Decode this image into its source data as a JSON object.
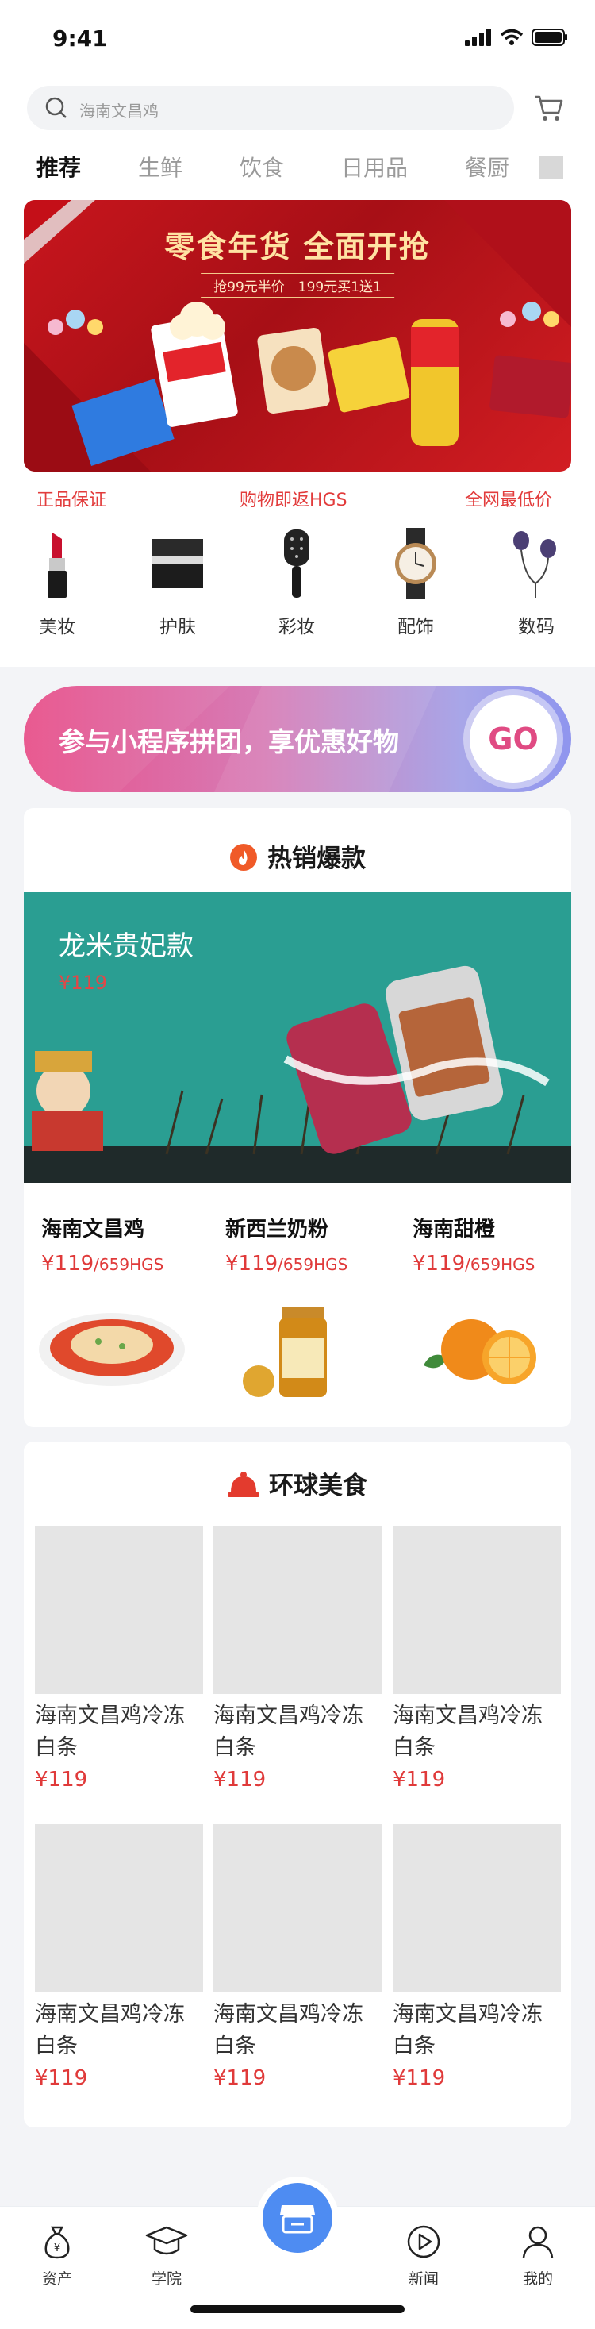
{
  "status": {
    "time": "9:41"
  },
  "search": {
    "placeholder": "海南文昌鸡"
  },
  "tabs": [
    "推荐",
    "生鲜",
    "饮食",
    "日用品",
    "餐厨"
  ],
  "banner": {
    "title": "零食年货 全面开抢",
    "subtitle": "抢99元半价　199元买1送1"
  },
  "guarantees": [
    "正品保证",
    "购物即返HGS",
    "全网最低价"
  ],
  "categories": [
    {
      "label": "美妆",
      "icon": "lipstick-icon"
    },
    {
      "label": "护肤",
      "icon": "skincare-box-icon"
    },
    {
      "label": "彩妆",
      "icon": "hairbrush-icon"
    },
    {
      "label": "配饰",
      "icon": "watch-icon"
    },
    {
      "label": "数码",
      "icon": "earphones-icon"
    }
  ],
  "promo": {
    "text": "参与小程序拼团，享优惠好物",
    "go": "GO"
  },
  "hot": {
    "title": "热销爆款",
    "hero": {
      "name": "龙米贵妃款",
      "price": "¥119"
    },
    "products": [
      {
        "name": "海南文昌鸡",
        "price": "¥119",
        "hgs": "/659HGS"
      },
      {
        "name": "新西兰奶粉",
        "price": "¥119",
        "hgs": "/659HGS"
      },
      {
        "name": "海南甜橙",
        "price": "¥119",
        "hgs": "/659HGS"
      }
    ]
  },
  "global": {
    "title": "环球美食",
    "items": [
      {
        "name": "海南文昌鸡冷冻白条",
        "price": "¥119"
      },
      {
        "name": "海南文昌鸡冷冻白条",
        "price": "¥119"
      },
      {
        "name": "海南文昌鸡冷冻白条",
        "price": "¥119"
      },
      {
        "name": "海南文昌鸡冷冻白条",
        "price": "¥119"
      },
      {
        "name": "海南文昌鸡冷冻白条",
        "price": "¥119"
      },
      {
        "name": "海南文昌鸡冷冻白条",
        "price": "¥119"
      }
    ]
  },
  "tabbar": [
    {
      "label": "资产",
      "icon": "money-bag-icon"
    },
    {
      "label": "学院",
      "icon": "graduation-cap-icon"
    },
    {
      "label": "新闻",
      "icon": "play-icon"
    },
    {
      "label": "我的",
      "icon": "user-icon"
    }
  ],
  "colors": {
    "accent_red": "#e03a3a",
    "teal": "#2a9e92",
    "center_blue": "#4e8cf2"
  }
}
